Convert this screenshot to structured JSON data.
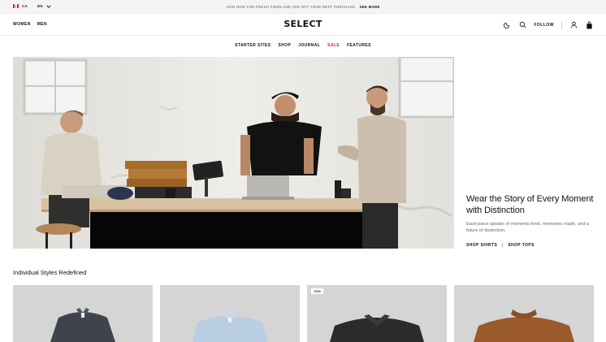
{
  "announcement": {
    "country": "CA",
    "language": "EN",
    "promo_text": "JOIN NOW FOR FRESH FINDS AND 15% OFF YOUR NEXT PURCHASE",
    "promo_link": "SEE MORE"
  },
  "header": {
    "nav_left": [
      "WOMEN",
      "MEN"
    ],
    "logo": "SELECT",
    "follow_label": "FOLLOW",
    "icons": [
      "moon-icon",
      "search-icon",
      "user-icon",
      "bag-icon"
    ]
  },
  "subnav": {
    "items": [
      "STARTER SITES",
      "SHOP",
      "JOURNAL",
      "SALE",
      "FEATURES"
    ],
    "sale_color": "#d2222d"
  },
  "hero": {
    "heading": "Wear the Story of Every Moment with Distinction",
    "body": "Each piece speaks of moments lived, memories made, and a future of distinction.",
    "links": [
      "SHOP SHIRTS",
      "SHOP TOPS"
    ]
  },
  "section": {
    "title": "Individual Styles Redefined",
    "cards": [
      {
        "color": "#3f444c",
        "badge": ""
      },
      {
        "color": "#b9cde3",
        "badge": ""
      },
      {
        "color": "#2b2b2d",
        "badge": "Sale"
      },
      {
        "color": "#9a5a2c",
        "badge": ""
      }
    ]
  }
}
